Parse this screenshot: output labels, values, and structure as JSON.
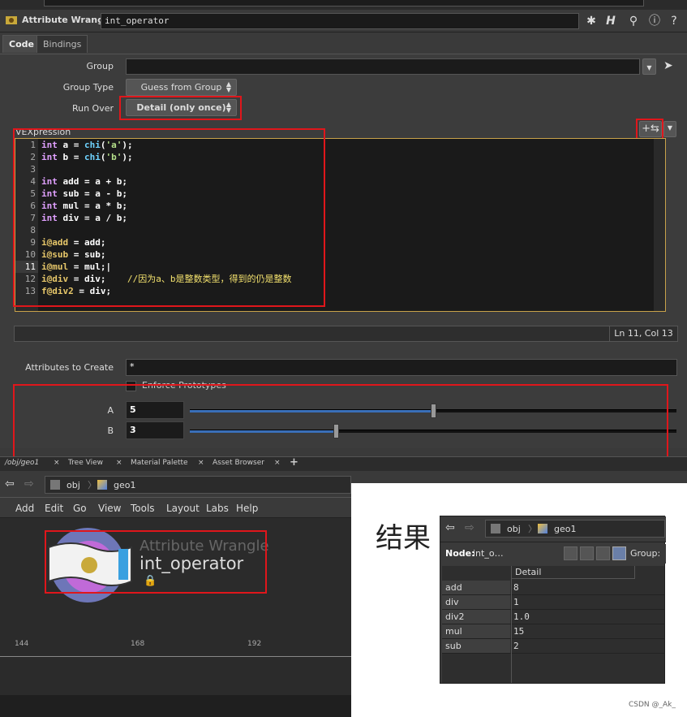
{
  "title_bar": {
    "node_type": "Attribute Wrangle",
    "node_name": "int_operator"
  },
  "tabs": [
    "Code",
    "Bindings"
  ],
  "params": {
    "group_label": "Group",
    "group_value": "",
    "group_type_label": "Group Type",
    "group_type_value": "Guess from Group",
    "run_over_label": "Run Over",
    "run_over_value": "Detail (only once)",
    "vex_label": "VEXpression"
  },
  "code": {
    "line_numbers": [
      "1",
      "2",
      "3",
      "4",
      "5",
      "6",
      "7",
      "8",
      "9",
      "10",
      "11",
      "12",
      "13"
    ],
    "current_line": "11",
    "cursor_status": "Ln 11, Col 13"
  },
  "attributes_to_create_label": "Attributes to Create",
  "attributes_to_create_value": "*",
  "enforce_prototypes_label": "Enforce Prototypes",
  "sliders": [
    {
      "label": "A",
      "value": "5",
      "fraction": 0.5
    },
    {
      "label": "B",
      "value": "3",
      "fraction": 0.3
    }
  ],
  "pane_tabs": [
    "/obj/geo1",
    "Tree View",
    "Material Palette",
    "Asset Browser"
  ],
  "nav_path": [
    "obj",
    "geo1"
  ],
  "menu": [
    "Add",
    "Edit",
    "Go",
    "View",
    "Tools",
    "Layout",
    "Labs",
    "Help"
  ],
  "network_node": {
    "type": "Attribute Wrangle",
    "name": "int_operator"
  },
  "timeline_ticks": [
    "144",
    "168",
    "192"
  ],
  "result": {
    "heading": "结果",
    "nav_path": [
      "obj",
      "geo1"
    ],
    "node_label": "Node:",
    "node_value": "int_o…",
    "group_label": "Group:",
    "column": "Detail",
    "rows": [
      {
        "name": "add",
        "value": "8"
      },
      {
        "name": "div",
        "value": "1"
      },
      {
        "name": "div2",
        "value": "1.0"
      },
      {
        "name": "mul",
        "value": "15"
      },
      {
        "name": "sub",
        "value": "2"
      }
    ]
  },
  "watermark": "CSDN @_Ak_"
}
